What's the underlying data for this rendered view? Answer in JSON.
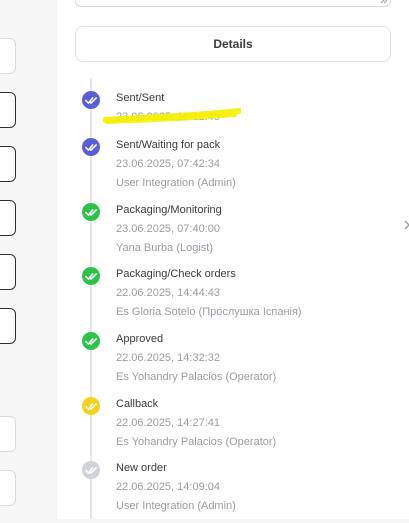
{
  "details_panel": {
    "details_button_label": "Details"
  },
  "status_colors": {
    "sent": "#5b5fd6",
    "done": "#2ec24a",
    "callback": "#f2d21b",
    "new": "#cfd2d8",
    "highlight": "#f5f000"
  },
  "history": [
    {
      "status": "Sent/Sent",
      "date": "23.06.2025, 15:12:45",
      "user": "",
      "icon": "double-check-icon",
      "color_key": "sent"
    },
    {
      "status": "Sent/Waiting for pack",
      "date": "23.06.2025, 07:42:34",
      "user": "User Integration (Admin)",
      "icon": "double-check-icon",
      "color_key": "sent"
    },
    {
      "status": "Packaging/Monitoring",
      "date": "23.06.2025, 07:40:00",
      "user": "Yana Burba (Logist)",
      "icon": "double-check-icon",
      "color_key": "done"
    },
    {
      "status": "Packaging/Check orders",
      "date": "22.06.2025, 14:44:43",
      "user": "Es Gloria Sotelo (Прослушка Іспанія)",
      "icon": "double-check-icon",
      "color_key": "done"
    },
    {
      "status": "Approved",
      "date": "22.06.2025, 14:32:32",
      "user": "Es Yohandry Palacios (Operator)",
      "icon": "double-check-icon",
      "color_key": "done"
    },
    {
      "status": "Callback",
      "date": "22.06.2025, 14:27:41",
      "user": "Es Yohandry Palacios (Operator)",
      "icon": "double-check-icon",
      "color_key": "callback"
    },
    {
      "status": "New order",
      "date": "22.06.2025, 14:09:04",
      "user": "User Integration (Admin)",
      "icon": "double-check-icon",
      "color_key": "new"
    }
  ]
}
